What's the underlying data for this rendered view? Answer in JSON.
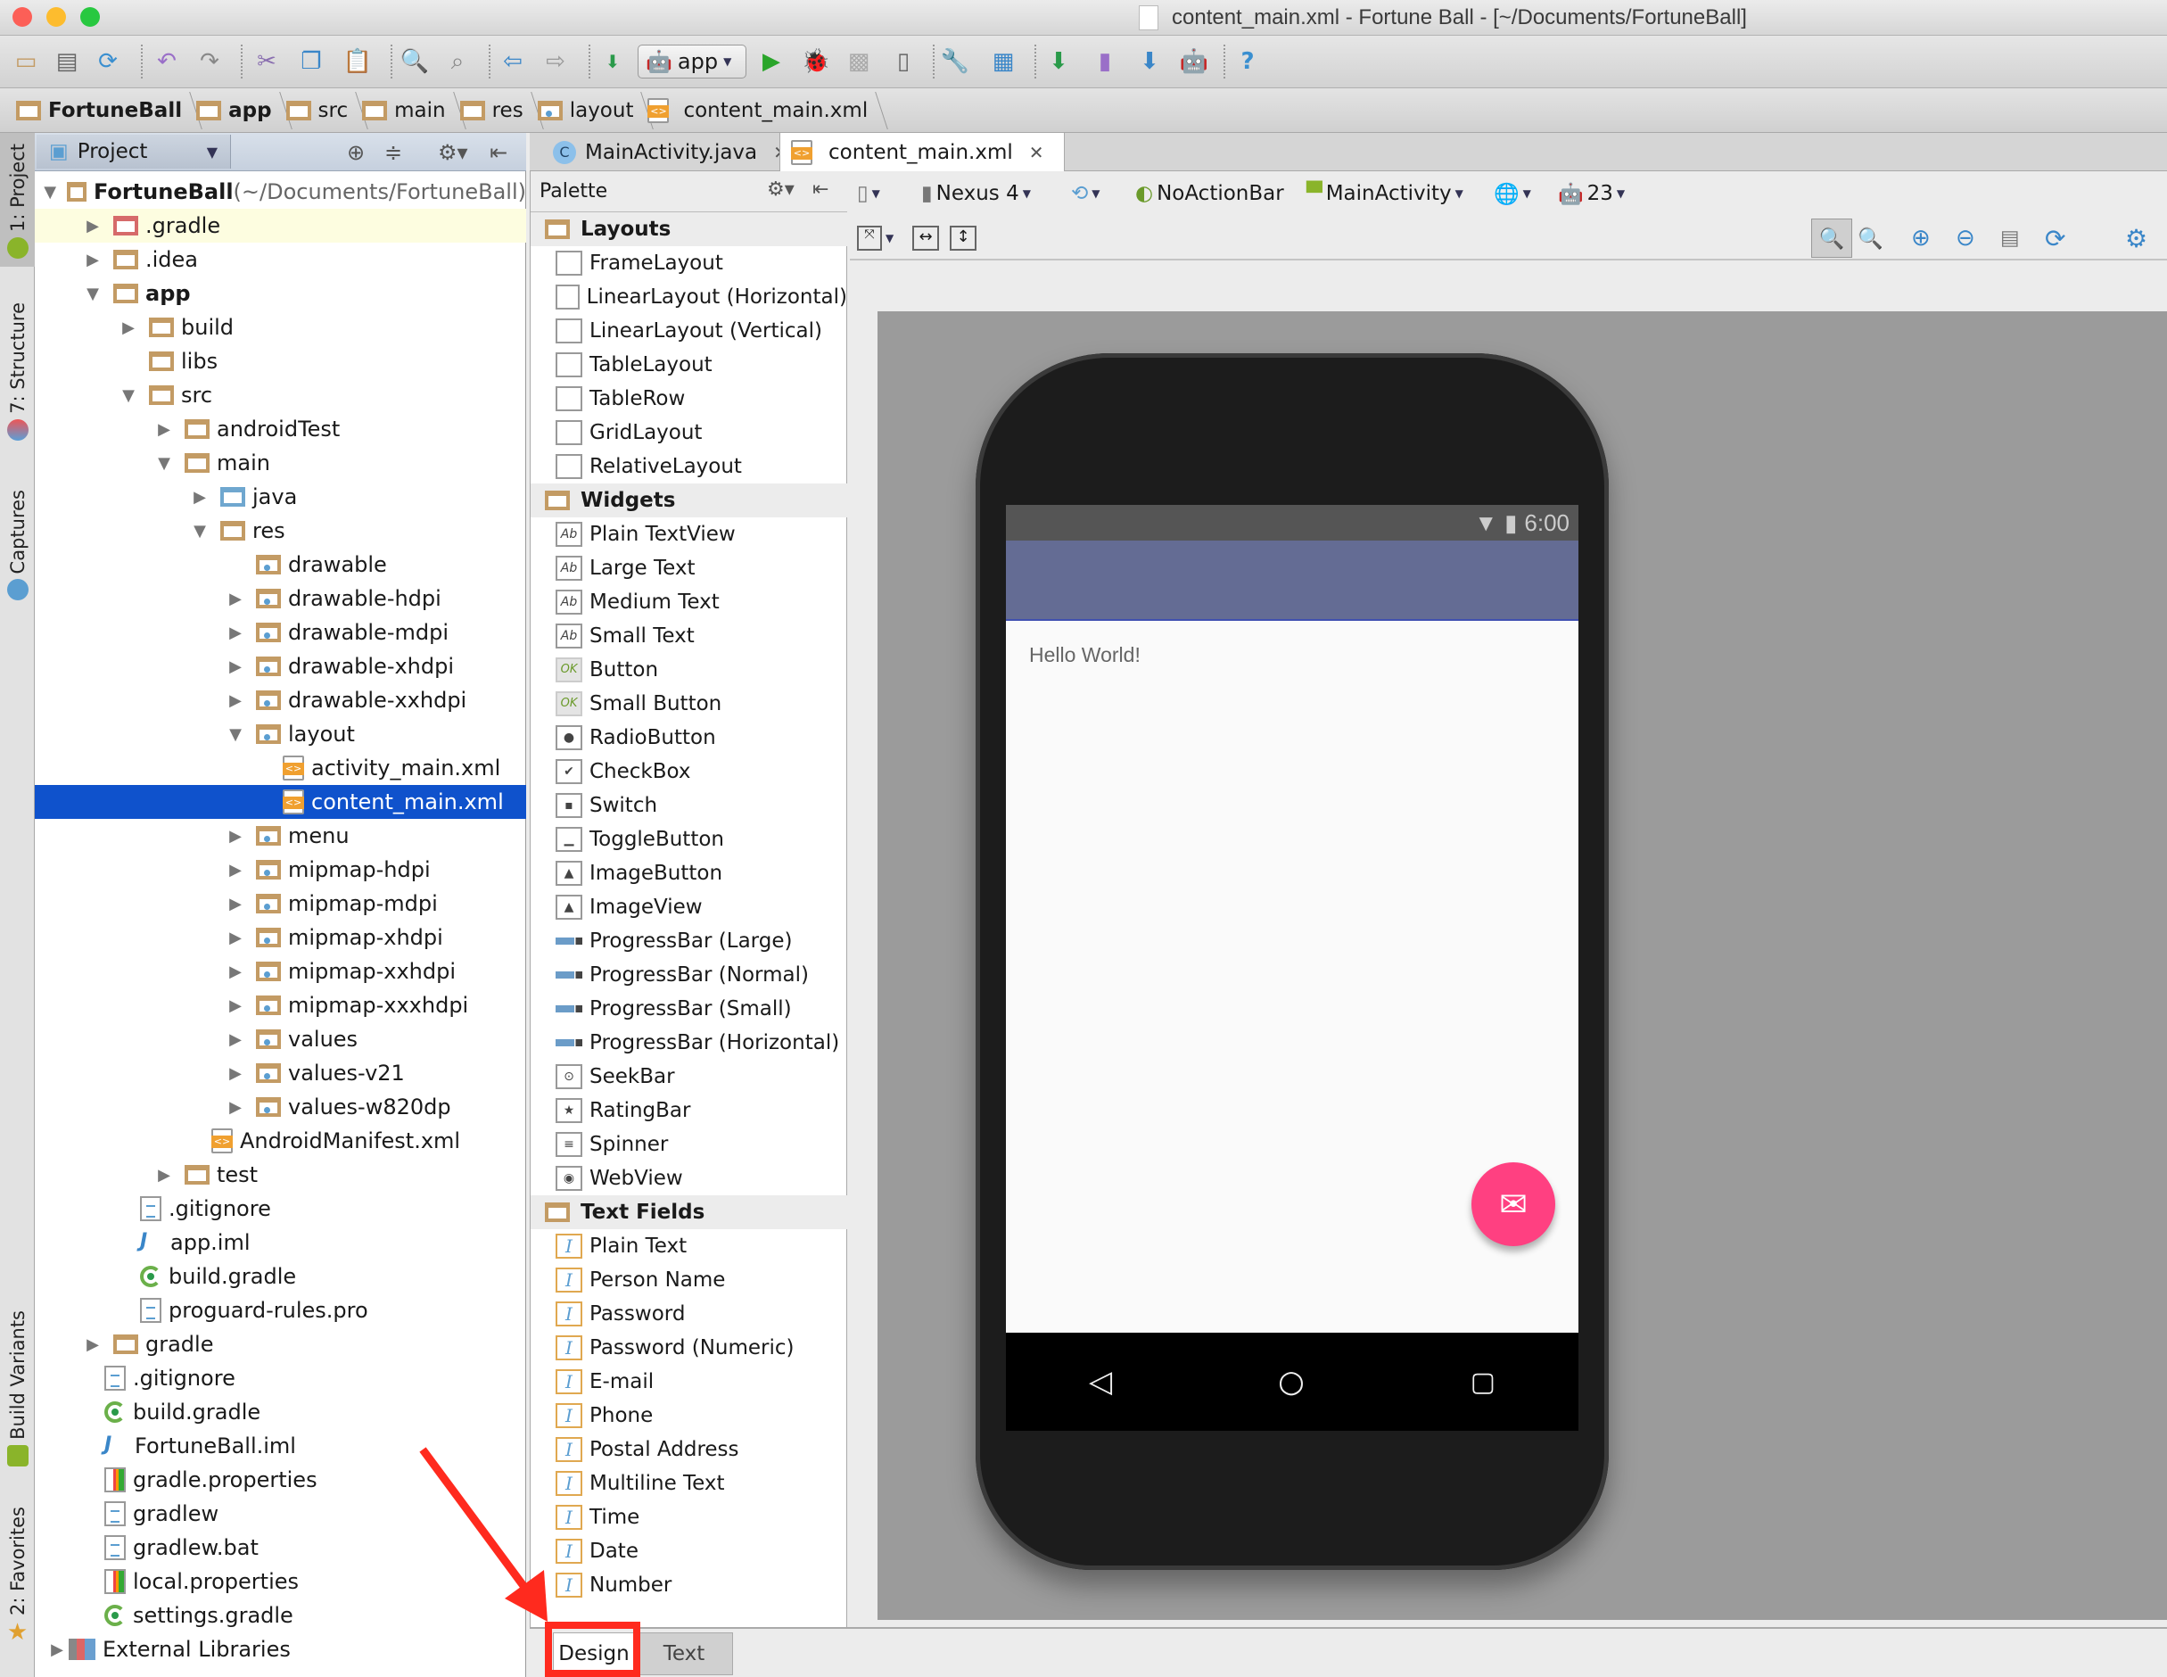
{
  "window": {
    "title": "content_main.xml - Fortune Ball - [~/Documents/FortuneBall]",
    "traffic_lights": {
      "close": "#fc5f57",
      "minimize": "#fdbc2e",
      "zoom": "#28c840"
    }
  },
  "toolbar": {
    "run_config": "app",
    "icons": [
      "open-folder-icon",
      "save-icon",
      "sync-icon",
      "undo-icon",
      "redo-icon",
      "cut-icon",
      "copy-icon",
      "paste-icon",
      "find-icon",
      "replace-icon",
      "back-icon",
      "forward-icon",
      "make-project-icon",
      "run-config-dropdown",
      "run-icon",
      "debug-icon",
      "coverage-icon",
      "attach-debugger-icon",
      "project-structure-icon",
      "sdk-layout-icon",
      "gradle-sync-icon",
      "avd-manager-icon",
      "sdk-manager-icon",
      "android-monitor-icon",
      "help-icon"
    ]
  },
  "breadcrumb": [
    {
      "label": "FortuneBall",
      "icon": "module-folder-icon",
      "bold": true
    },
    {
      "label": "app",
      "icon": "module-folder-icon",
      "bold": true
    },
    {
      "label": "src",
      "icon": "folder-icon"
    },
    {
      "label": "main",
      "icon": "folder-icon"
    },
    {
      "label": "res",
      "icon": "res-folder-icon"
    },
    {
      "label": "layout",
      "icon": "res-folder-icon"
    },
    {
      "label": "content_main.xml",
      "icon": "xml-file-icon"
    }
  ],
  "left_tool_tabs": [
    {
      "label": "1: Project",
      "active": true
    },
    {
      "label": "7: Structure"
    },
    {
      "label": "Captures"
    },
    {
      "label": "Build Variants"
    },
    {
      "label": "2: Favorites"
    }
  ],
  "project_panel": {
    "view_selector": "Project",
    "tree": [
      {
        "label": "FortuneBall",
        "suffix": " (~/Documents/FortuneBall)",
        "depth": 0,
        "state": "open",
        "icon": "module",
        "bold": true
      },
      {
        "label": ".gradle",
        "depth": 1,
        "state": "closed",
        "icon": "folder-red",
        "highlight": true
      },
      {
        "label": ".idea",
        "depth": 1,
        "state": "closed",
        "icon": "folder"
      },
      {
        "label": "app",
        "depth": 1,
        "state": "open",
        "icon": "folder",
        "bold": true
      },
      {
        "label": "build",
        "depth": 2,
        "state": "closed",
        "icon": "folder"
      },
      {
        "label": "libs",
        "depth": 2,
        "state": "none",
        "icon": "folder"
      },
      {
        "label": "src",
        "depth": 2,
        "state": "open",
        "icon": "folder"
      },
      {
        "label": "androidTest",
        "depth": 3,
        "state": "closed",
        "icon": "folder"
      },
      {
        "label": "main",
        "depth": 3,
        "state": "open",
        "icon": "folder"
      },
      {
        "label": "java",
        "depth": 4,
        "state": "closed",
        "icon": "folder-blue"
      },
      {
        "label": "res",
        "depth": 4,
        "state": "open",
        "icon": "folder"
      },
      {
        "label": "drawable",
        "depth": 5,
        "state": "none",
        "icon": "folder-res"
      },
      {
        "label": "drawable-hdpi",
        "depth": 5,
        "state": "closed",
        "icon": "folder-res"
      },
      {
        "label": "drawable-mdpi",
        "depth": 5,
        "state": "closed",
        "icon": "folder-res"
      },
      {
        "label": "drawable-xhdpi",
        "depth": 5,
        "state": "closed",
        "icon": "folder-res"
      },
      {
        "label": "drawable-xxhdpi",
        "depth": 5,
        "state": "closed",
        "icon": "folder-res"
      },
      {
        "label": "layout",
        "depth": 5,
        "state": "open",
        "icon": "folder-res"
      },
      {
        "label": "activity_main.xml",
        "depth": 6,
        "state": "none",
        "icon": "xml"
      },
      {
        "label": "content_main.xml",
        "depth": 6,
        "state": "none",
        "icon": "xml",
        "selected": true
      },
      {
        "label": "menu",
        "depth": 5,
        "state": "closed",
        "icon": "folder-res"
      },
      {
        "label": "mipmap-hdpi",
        "depth": 5,
        "state": "closed",
        "icon": "folder-res"
      },
      {
        "label": "mipmap-mdpi",
        "depth": 5,
        "state": "closed",
        "icon": "folder-res"
      },
      {
        "label": "mipmap-xhdpi",
        "depth": 5,
        "state": "closed",
        "icon": "folder-res"
      },
      {
        "label": "mipmap-xxhdpi",
        "depth": 5,
        "state": "closed",
        "icon": "folder-res"
      },
      {
        "label": "mipmap-xxxhdpi",
        "depth": 5,
        "state": "closed",
        "icon": "folder-res"
      },
      {
        "label": "values",
        "depth": 5,
        "state": "closed",
        "icon": "folder-res"
      },
      {
        "label": "values-v21",
        "depth": 5,
        "state": "closed",
        "icon": "folder-res"
      },
      {
        "label": "values-w820dp",
        "depth": 5,
        "state": "closed",
        "icon": "folder-res"
      },
      {
        "label": "AndroidManifest.xml",
        "depth": 4,
        "state": "none",
        "icon": "xml"
      },
      {
        "label": "test",
        "depth": 3,
        "state": "closed",
        "icon": "folder"
      },
      {
        "label": ".gitignore",
        "depth": 2,
        "state": "none",
        "icon": "txt"
      },
      {
        "label": "app.iml",
        "depth": 2,
        "state": "none",
        "icon": "iml"
      },
      {
        "label": "build.gradle",
        "depth": 2,
        "state": "none",
        "icon": "gradle"
      },
      {
        "label": "proguard-rules.pro",
        "depth": 2,
        "state": "none",
        "icon": "txt"
      },
      {
        "label": "gradle",
        "depth": 1,
        "state": "closed",
        "icon": "folder"
      },
      {
        "label": ".gitignore",
        "depth": 1,
        "state": "none",
        "icon": "txt"
      },
      {
        "label": "build.gradle",
        "depth": 1,
        "state": "none",
        "icon": "gradle"
      },
      {
        "label": "FortuneBall.iml",
        "depth": 1,
        "state": "none",
        "icon": "iml"
      },
      {
        "label": "gradle.properties",
        "depth": 1,
        "state": "none",
        "icon": "props"
      },
      {
        "label": "gradlew",
        "depth": 1,
        "state": "none",
        "icon": "txt"
      },
      {
        "label": "gradlew.bat",
        "depth": 1,
        "state": "none",
        "icon": "txt"
      },
      {
        "label": "local.properties",
        "depth": 1,
        "state": "none",
        "icon": "props"
      },
      {
        "label": "settings.gradle",
        "depth": 1,
        "state": "none",
        "icon": "gradle"
      },
      {
        "label": "External Libraries",
        "depth": 0,
        "state": "closed",
        "icon": "lib"
      }
    ]
  },
  "editor_tabs": [
    {
      "label": "MainActivity.java",
      "icon": "java-class-icon",
      "active": false
    },
    {
      "label": "content_main.xml",
      "icon": "xml-file-icon",
      "active": true
    }
  ],
  "palette": {
    "title": "Palette",
    "rows": [
      {
        "type": "cat",
        "label": "Layouts"
      },
      {
        "label": "FrameLayout",
        "icon": ""
      },
      {
        "label": "LinearLayout (Horizontal)",
        "icon": ""
      },
      {
        "label": "LinearLayout (Vertical)",
        "icon": ""
      },
      {
        "label": "TableLayout",
        "icon": ""
      },
      {
        "label": "TableRow",
        "icon": ""
      },
      {
        "label": "GridLayout",
        "icon": ""
      },
      {
        "label": "RelativeLayout",
        "icon": ""
      },
      {
        "type": "cat",
        "label": "Widgets"
      },
      {
        "label": "Plain TextView",
        "icon": "Ab"
      },
      {
        "label": "Large Text",
        "icon": "Ab"
      },
      {
        "label": "Medium Text",
        "icon": "Ab"
      },
      {
        "label": "Small Text",
        "icon": "Ab"
      },
      {
        "label": "Button",
        "icon": "OK",
        "kind": "ok"
      },
      {
        "label": "Small Button",
        "icon": "OK",
        "kind": "ok"
      },
      {
        "label": "RadioButton",
        "icon": "●"
      },
      {
        "label": "CheckBox",
        "icon": "✔"
      },
      {
        "label": "Switch",
        "icon": "▪"
      },
      {
        "label": "ToggleButton",
        "icon": "▁"
      },
      {
        "label": "ImageButton",
        "icon": "▲"
      },
      {
        "label": "ImageView",
        "icon": "▲"
      },
      {
        "label": "ProgressBar (Large)",
        "icon": "",
        "kind": "bar"
      },
      {
        "label": "ProgressBar (Normal)",
        "icon": "",
        "kind": "bar"
      },
      {
        "label": "ProgressBar (Small)",
        "icon": "",
        "kind": "bar"
      },
      {
        "label": "ProgressBar (Horizontal)",
        "icon": "",
        "kind": "bar"
      },
      {
        "label": "SeekBar",
        "icon": "⊙"
      },
      {
        "label": "RatingBar",
        "icon": "★"
      },
      {
        "label": "Spinner",
        "icon": "≡"
      },
      {
        "label": "WebView",
        "icon": "◉"
      },
      {
        "type": "cat",
        "label": "Text Fields"
      },
      {
        "label": "Plain Text",
        "icon": "I",
        "kind": "tf"
      },
      {
        "label": "Person Name",
        "icon": "I",
        "kind": "tf"
      },
      {
        "label": "Password",
        "icon": "I",
        "kind": "tf"
      },
      {
        "label": "Password (Numeric)",
        "icon": "I",
        "kind": "tf"
      },
      {
        "label": "E-mail",
        "icon": "I",
        "kind": "tf"
      },
      {
        "label": "Phone",
        "icon": "I",
        "kind": "tf"
      },
      {
        "label": "Postal Address",
        "icon": "I",
        "kind": "tf"
      },
      {
        "label": "Multiline Text",
        "icon": "I",
        "kind": "tf"
      },
      {
        "label": "Time",
        "icon": "I",
        "kind": "tf"
      },
      {
        "label": "Date",
        "icon": "I",
        "kind": "tf"
      },
      {
        "label": "Number",
        "icon": "I",
        "kind": "tf"
      }
    ]
  },
  "design_toolbar": {
    "device": "Nexus 4",
    "theme": "NoActionBar",
    "activity": "MainActivity",
    "api_level": "23"
  },
  "device_preview": {
    "status_time": "6:00",
    "content_text": "Hello World!",
    "app_bar_color": "#646c94",
    "fab_color": "#ff4081"
  },
  "bottom_tabs": {
    "design": "Design",
    "text": "Text",
    "active": "Design"
  },
  "annotation": {
    "color": "#ff2a1e",
    "target": "Design tab"
  }
}
